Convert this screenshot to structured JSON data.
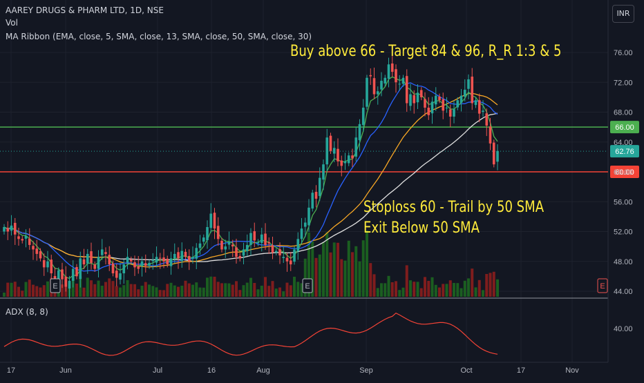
{
  "header": {
    "symbol_line": "AAREY DRUGS & PHARM LTD, 1D, NSE",
    "vol_label": "Vol",
    "ma_ribbon": "MA Ribbon (EMA, close, 5, SMA, close, 13, SMA, close, 50, SMA, close, 30)",
    "currency": "INR"
  },
  "annotations": {
    "buy": "Buy above 66 - Target 84 & 96, R_R 1:3 & 5",
    "stop_line1": "Stoploss 60 - Trail by 50 SMA",
    "stop_line2": "Exit Below 50 SMA"
  },
  "colors": {
    "background": "#131722",
    "up": "#26a69a",
    "down": "#ef5350",
    "volume_up": "#1b5e20",
    "volume_down": "#7f1d1d",
    "ema5": "#4caf50",
    "sma13": "#2962ff",
    "sma30": "#f9a825",
    "sma50": "#e0e0e0",
    "adx": "#f44336",
    "buy_line": "#4caf50",
    "stop_line": "#f44336",
    "annotation": "#ffeb3b"
  },
  "chart_data": [
    {
      "type": "candlestick",
      "title": "AAREY DRUGS & PHARM LTD, 1D, NSE",
      "x_ticks": [
        "17",
        "Jun",
        "Jul",
        "16",
        "Aug",
        "Sep",
        "Oct",
        "17",
        "Nov"
      ],
      "y_ticks": [
        "76.00",
        "72.00",
        "68.00",
        "64.00",
        "60.00",
        "56.00",
        "52.00",
        "48.00",
        "44.00"
      ],
      "ylim": [
        44,
        77.5
      ],
      "grid": true,
      "last_price": "62.76",
      "horizontal_lines": [
        {
          "value": 66,
          "label": "66.00",
          "color": "#4caf50"
        },
        {
          "value": 60,
          "label": "60.00",
          "color": "#f44336"
        }
      ],
      "earnings_markers": [
        "E",
        "E",
        "E"
      ],
      "closes": [
        52.6,
        52.0,
        52.8,
        51.6,
        51.0,
        50.8,
        51.4,
        50.2,
        49.6,
        49.0,
        48.4,
        47.2,
        48.0,
        46.4,
        45.6,
        46.8,
        45.6,
        44.6,
        45.4,
        47.0,
        46.0,
        48.4,
        47.6,
        49.0,
        47.8,
        47.0,
        48.6,
        49.6,
        49.0,
        47.6,
        46.4,
        45.8,
        46.4,
        47.6,
        48.6,
        48.0,
        47.2,
        47.0,
        48.0,
        47.4,
        47.8,
        48.2,
        48.6,
        48.4,
        48.0,
        47.6,
        48.4,
        49.0,
        48.4,
        49.4,
        48.6,
        48.0,
        48.6,
        49.8,
        50.4,
        51.2,
        52.6,
        54.4,
        52.4,
        51.0,
        49.6,
        50.0,
        50.6,
        50.0,
        48.6,
        48.4,
        49.6,
        50.2,
        51.8,
        50.8,
        50.6,
        51.6,
        50.2,
        50.4,
        49.2,
        49.4,
        48.8,
        48.6,
        48.0,
        47.6,
        49.6,
        51.0,
        52.4,
        53.2,
        55.2,
        57.2,
        56.4,
        59.2,
        61.0,
        64.6,
        62.8,
        63.2,
        61.4,
        60.8,
        61.4,
        62.2,
        61.8,
        64.6,
        66.4,
        68.6,
        72.6,
        72.8,
        70.4,
        70.8,
        72.2,
        72.6,
        74.4,
        73.4,
        72.0,
        71.8,
        72.6,
        69.2,
        70.4,
        69.2,
        70.6,
        70.0,
        68.6,
        67.6,
        69.4,
        70.2,
        69.6,
        68.2,
        68.6,
        67.4,
        68.4,
        69.6,
        70.2,
        71.0,
        72.4,
        69.2,
        69.6,
        67.8,
        68.2,
        66.2,
        63.8,
        61.0,
        62.8
      ],
      "volume": "relative volume bars",
      "series": [
        {
          "name": "EMA 5"
        },
        {
          "name": "SMA 13"
        },
        {
          "name": "SMA 30"
        },
        {
          "name": "SMA 50"
        }
      ]
    },
    {
      "type": "line",
      "title": "ADX (8, 8)",
      "y_ticks": [
        "40.00"
      ],
      "series": [
        {
          "name": "ADX (8, 8)"
        }
      ]
    }
  ]
}
